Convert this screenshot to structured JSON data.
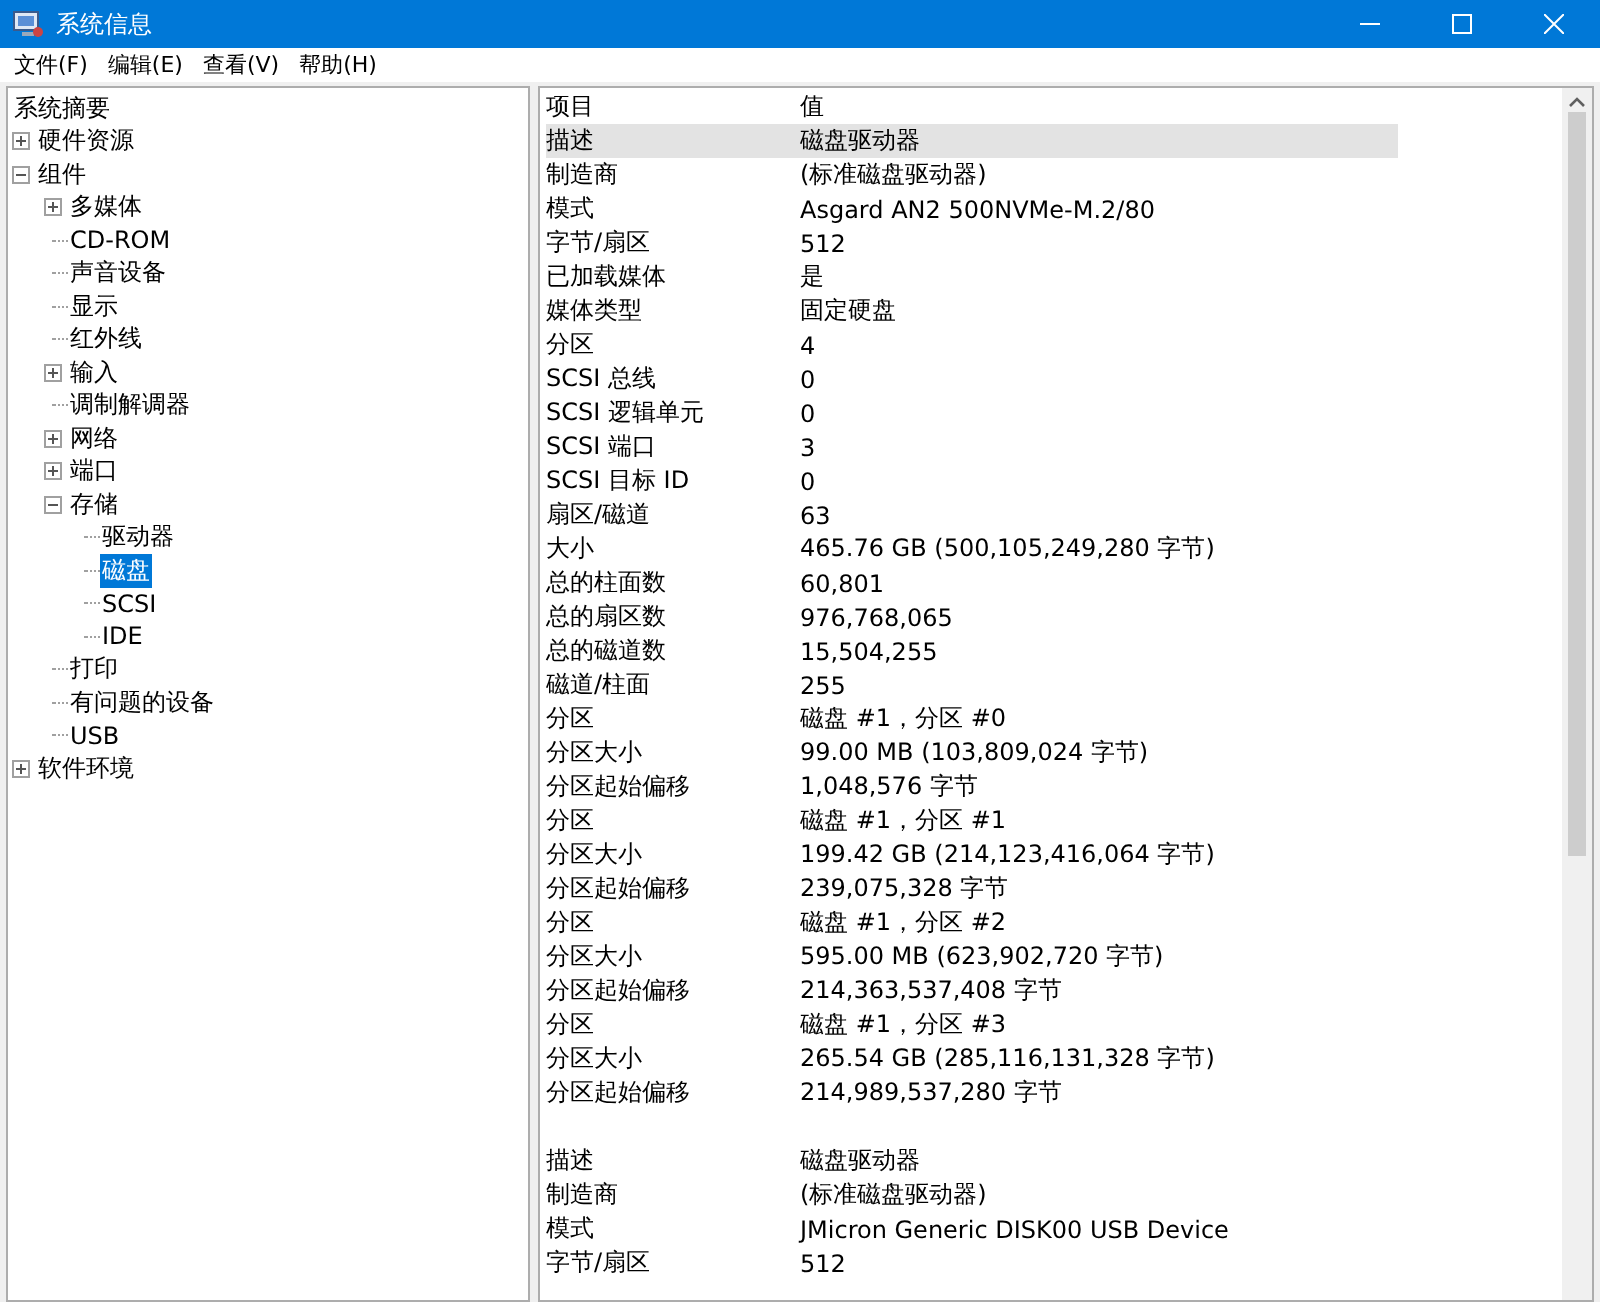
{
  "window": {
    "title": "系统信息"
  },
  "menu": [
    "文件(F)",
    "编辑(E)",
    "查看(V)",
    "帮助(H)"
  ],
  "tree": [
    {
      "label": "系统摘要",
      "selected": false
    },
    {
      "label": "硬件资源",
      "selected": false,
      "expanded": false
    },
    {
      "label": "组件",
      "selected": false,
      "expanded": true,
      "children": [
        {
          "label": "多媒体",
          "selected": false,
          "expanded": false
        },
        {
          "label": "CD-ROM",
          "selected": false
        },
        {
          "label": "声音设备",
          "selected": false
        },
        {
          "label": "显示",
          "selected": false
        },
        {
          "label": "红外线",
          "selected": false
        },
        {
          "label": "输入",
          "selected": false,
          "expanded": false
        },
        {
          "label": "调制解调器",
          "selected": false
        },
        {
          "label": "网络",
          "selected": false,
          "expanded": false
        },
        {
          "label": "端口",
          "selected": false,
          "expanded": false
        },
        {
          "label": "存储",
          "selected": false,
          "expanded": true,
          "children": [
            {
              "label": "驱动器",
              "selected": false
            },
            {
              "label": "磁盘",
              "selected": true
            },
            {
              "label": "SCSI",
              "selected": false
            },
            {
              "label": "IDE",
              "selected": false
            }
          ]
        },
        {
          "label": "打印",
          "selected": false
        },
        {
          "label": "有问题的设备",
          "selected": false
        },
        {
          "label": "USB",
          "selected": false
        }
      ]
    },
    {
      "label": "软件环境",
      "selected": false,
      "expanded": false
    }
  ],
  "table": {
    "columns": [
      "项目",
      "值"
    ],
    "groups": [
      {
        "rows": [
          {
            "item": "描述",
            "value": "磁盘驱动器",
            "selected": true
          },
          {
            "item": "制造商",
            "value": "(标准磁盘驱动器)",
            "selected": false
          },
          {
            "item": "模式",
            "value": "Asgard AN2 500NVMe-M.2/80",
            "selected": false
          },
          {
            "item": "字节/扇区",
            "value": "512",
            "selected": false
          },
          {
            "item": "已加载媒体",
            "value": "是",
            "selected": false
          },
          {
            "item": "媒体类型",
            "value": "固定硬盘",
            "selected": false
          },
          {
            "item": "分区",
            "value": "4",
            "selected": false
          },
          {
            "item": "SCSI 总线",
            "value": "0",
            "selected": false
          },
          {
            "item": "SCSI 逻辑单元",
            "value": "0",
            "selected": false
          },
          {
            "item": "SCSI 端口",
            "value": "3",
            "selected": false
          },
          {
            "item": "SCSI 目标 ID",
            "value": "0",
            "selected": false
          },
          {
            "item": "扇区/磁道",
            "value": "63",
            "selected": false
          },
          {
            "item": "大小",
            "value": "465.76 GB (500,105,249,280 字节)",
            "selected": false
          },
          {
            "item": "总的柱面数",
            "value": "60,801",
            "selected": false
          },
          {
            "item": "总的扇区数",
            "value": "976,768,065",
            "selected": false
          },
          {
            "item": "总的磁道数",
            "value": "15,504,255",
            "selected": false
          },
          {
            "item": "磁道/柱面",
            "value": "255",
            "selected": false
          },
          {
            "item": "分区",
            "value": "磁盘 #1，分区 #0",
            "selected": false
          },
          {
            "item": "分区大小",
            "value": "99.00 MB (103,809,024 字节)",
            "selected": false
          },
          {
            "item": "分区起始偏移",
            "value": "1,048,576 字节",
            "selected": false
          },
          {
            "item": "分区",
            "value": "磁盘 #1，分区 #1",
            "selected": false
          },
          {
            "item": "分区大小",
            "value": "199.42 GB (214,123,416,064 字节)",
            "selected": false
          },
          {
            "item": "分区起始偏移",
            "value": "239,075,328 字节",
            "selected": false
          },
          {
            "item": "分区",
            "value": "磁盘 #1，分区 #2",
            "selected": false
          },
          {
            "item": "分区大小",
            "value": "595.00 MB (623,902,720 字节)",
            "selected": false
          },
          {
            "item": "分区起始偏移",
            "value": "214,363,537,408 字节",
            "selected": false
          },
          {
            "item": "分区",
            "value": "磁盘 #1，分区 #3",
            "selected": false
          },
          {
            "item": "分区大小",
            "value": "265.54 GB (285,116,131,328 字节)",
            "selected": false
          },
          {
            "item": "分区起始偏移",
            "value": "214,989,537,280 字节",
            "selected": false
          }
        ]
      },
      {
        "rows": [
          {
            "item": "描述",
            "value": "磁盘驱动器",
            "selected": false
          },
          {
            "item": "制造商",
            "value": "(标准磁盘驱动器)",
            "selected": false
          },
          {
            "item": "模式",
            "value": "JMicron Generic DISK00 USB Device",
            "selected": false
          },
          {
            "item": "字节/扇区",
            "value": "512",
            "selected": false
          }
        ]
      }
    ]
  }
}
